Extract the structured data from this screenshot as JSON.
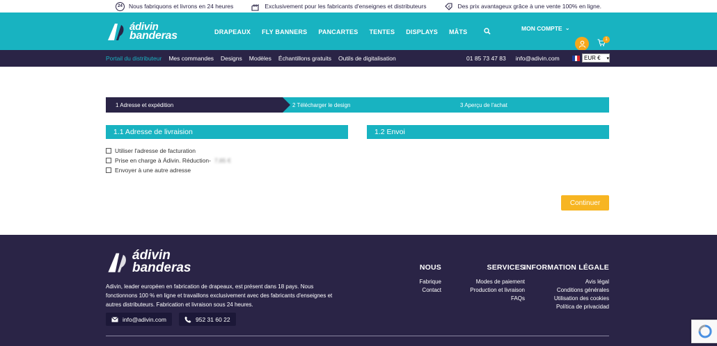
{
  "topbar": {
    "items": [
      {
        "icon": "24h-icon",
        "text": "Nous fabriquons et livrons en 24 heures"
      },
      {
        "icon": "factory-icon",
        "text": "Exclusivement pour les fabricants d'enseignes et distributeurs"
      },
      {
        "icon": "euro-tag-icon",
        "text": "Des prix avantageux grâce à une vente 100% en ligne."
      }
    ]
  },
  "header": {
    "logo_line1": "ádivin",
    "logo_line2": "banderas",
    "nav": [
      "DRAPEAUX",
      "FLY BANNERS",
      "PANCARTES",
      "TENTES",
      "DISPLAYS",
      "MÂTS"
    ],
    "account_label": "MON COMPTE",
    "cart_count": "1",
    "brand_color": "#18b3c1",
    "dark_color": "#2a2446",
    "accent_color": "#f7a81b"
  },
  "subnav": {
    "items": [
      "Portail du distributeur",
      "Mes commandes",
      "Designs",
      "Modèles",
      "Échantillons gratuits",
      "Outils de digitalisation"
    ],
    "phone": "01 85 73 47 83",
    "email": "info@adivin.com",
    "currency": "EUR €"
  },
  "steps": {
    "step1": "1 Adresse et expédition",
    "step2": "2 Télécharger le design",
    "step3": "3 Aperçu de l'achat"
  },
  "sections": {
    "delivery_title": "1.1 Adresse de livraision",
    "shipping_title": "1.2 Envoi"
  },
  "options": {
    "opt1": "Utiliser l'adresse de facturation",
    "opt2": "Prise en charge à Ádivin. Réduction-",
    "opt2_blurred": "7,65 €",
    "opt3": "Envoyer à une autre adresse"
  },
  "continue_label": "Continuer",
  "footer": {
    "logo_line1": "ádivin",
    "logo_line2": "banderas",
    "description": "Adivin, leader européen en fabrication de drapeaux, est présent dans 18 pays. Nous fonctionnons 100 % en ligne et travaillons exclusivement avec des fabricants d'enseignes et autres distributeurs. Fabrication et livraison sous 24 heures.",
    "email": "info@adivin.com",
    "phone": "952 31 60 22",
    "col1": {
      "title": "NOUS",
      "links": [
        "Fabrique",
        "Contact"
      ]
    },
    "col2": {
      "title": "SERVICES",
      "links": [
        "Modes de paiement",
        "Production et livraison",
        "FAQs"
      ]
    },
    "col3": {
      "title": "INFORMATION LÉGALE",
      "links": [
        "Avis légal",
        "Conditions générales",
        "Utilisation des cookies",
        "Política de privacidad"
      ]
    }
  }
}
